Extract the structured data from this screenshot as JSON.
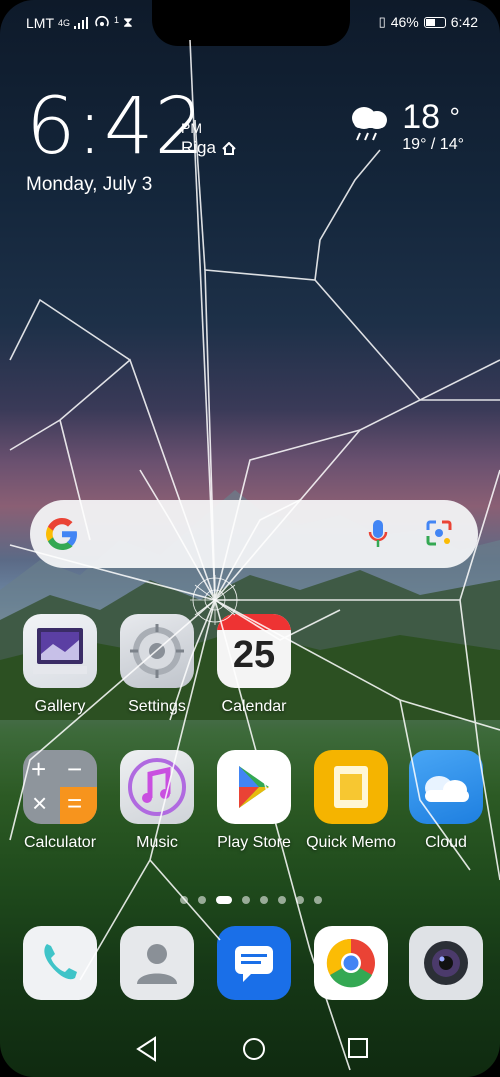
{
  "status_bar": {
    "carrier": "LMT",
    "network": "4G",
    "hotspot_count": "1",
    "battery": "46%",
    "time": "6:42"
  },
  "clock_widget": {
    "time": "6:42",
    "ampm": "PM",
    "city": "Riga",
    "date": "Monday, July 3"
  },
  "weather_widget": {
    "temperature": "18",
    "degree_symbol": "°",
    "high_low": "19° / 14°",
    "condition_icon": "rain-cloud-icon"
  },
  "search_bar": {
    "logo": "G",
    "mic_icon": "mic-icon",
    "lens_icon": "lens-icon"
  },
  "apps_row1": [
    {
      "label": "Gallery",
      "icon": "gallery-icon"
    },
    {
      "label": "Settings",
      "icon": "settings-gear-icon"
    },
    {
      "label": "Calendar",
      "icon": "calendar-icon",
      "day": "25"
    }
  ],
  "apps_row2": [
    {
      "label": "Calculator",
      "icon": "calculator-icon"
    },
    {
      "label": "Music",
      "icon": "music-note-icon"
    },
    {
      "label": "Play Store",
      "icon": "play-store-icon"
    },
    {
      "label": "Quick Memo",
      "icon": "memo-icon"
    },
    {
      "label": "Cloud",
      "icon": "cloud-icon"
    }
  ],
  "dock": [
    {
      "icon": "phone-icon"
    },
    {
      "icon": "contacts-icon"
    },
    {
      "icon": "messages-icon"
    },
    {
      "icon": "chrome-icon"
    },
    {
      "icon": "camera-icon"
    }
  ],
  "page_indicator": {
    "count": 8,
    "active": 2
  },
  "colors": {
    "calc_orange": "#f7941d",
    "play_store_green": "#34a853",
    "memo_yellow": "#f5b400",
    "cloud_blue": "#2b8fe8",
    "messages_blue": "#1a6fe8"
  }
}
